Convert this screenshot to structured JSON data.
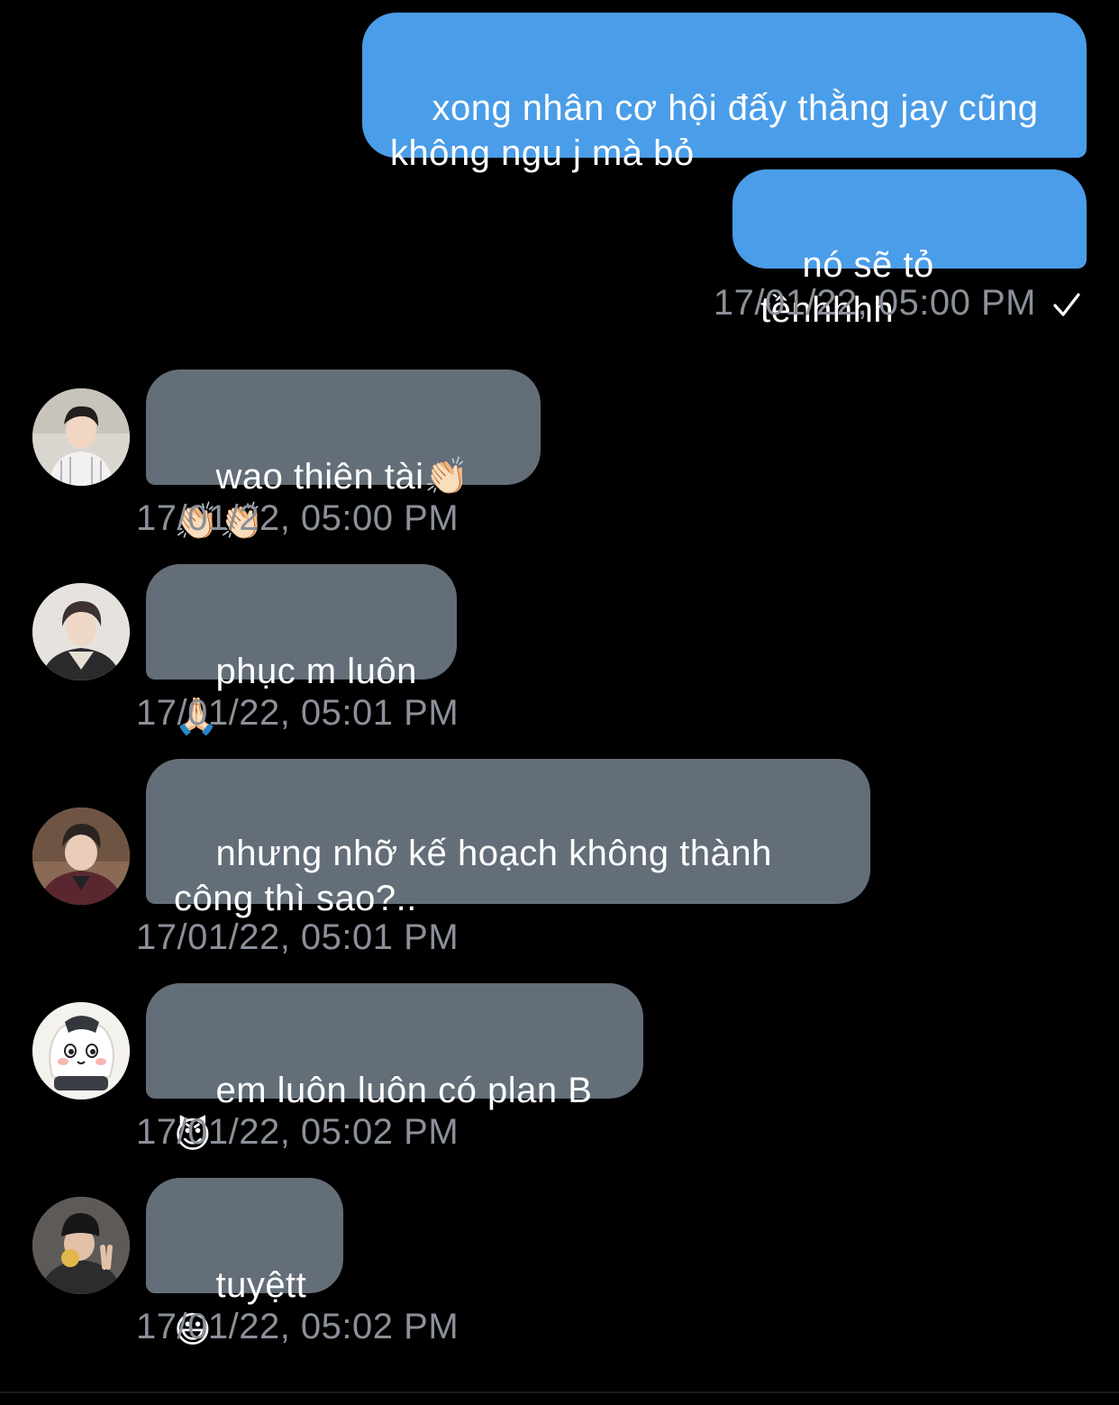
{
  "messages": [
    {
      "direction": "outgoing",
      "text": "xong nhân cơ hội đấy thằng jay cũng không ngu j mà bỏ"
    },
    {
      "direction": "outgoing",
      "text": "nó sẽ tỏ tềnhhhh",
      "timestamp": "17/01/22, 05:00 PM",
      "status_icon": "check-icon"
    },
    {
      "direction": "incoming",
      "avatar": "avatar-boy-striped-shirt",
      "text": "wao thiên tài👏🏻👏🏻👏🏻",
      "timestamp": "17/01/22, 05:00 PM"
    },
    {
      "direction": "incoming",
      "avatar": "avatar-boy-dark-jacket",
      "text": "phục m luôn🙏🏻",
      "timestamp": "17/01/22, 05:01 PM"
    },
    {
      "direction": "incoming",
      "avatar": "avatar-boy-maroon-jacket",
      "text": "nhưng nhỡ kế hoạch không thành công thì sao?..",
      "timestamp": "17/01/22, 05:01 PM"
    },
    {
      "direction": "incoming",
      "avatar": "avatar-cartoon-rice-ball",
      "text": "em luôn luôn có plan B😈",
      "timestamp": "17/01/22, 05:02 PM"
    },
    {
      "direction": "incoming",
      "avatar": "avatar-boy-beanie-peace",
      "text": "tuyệtt😃",
      "timestamp": "17/01/22, 05:02 PM"
    }
  ],
  "colors": {
    "background": "#000000",
    "outgoing_bubble": "#4a9de8",
    "incoming_bubble": "#646e79",
    "timestamp_text": "#8b9099"
  }
}
